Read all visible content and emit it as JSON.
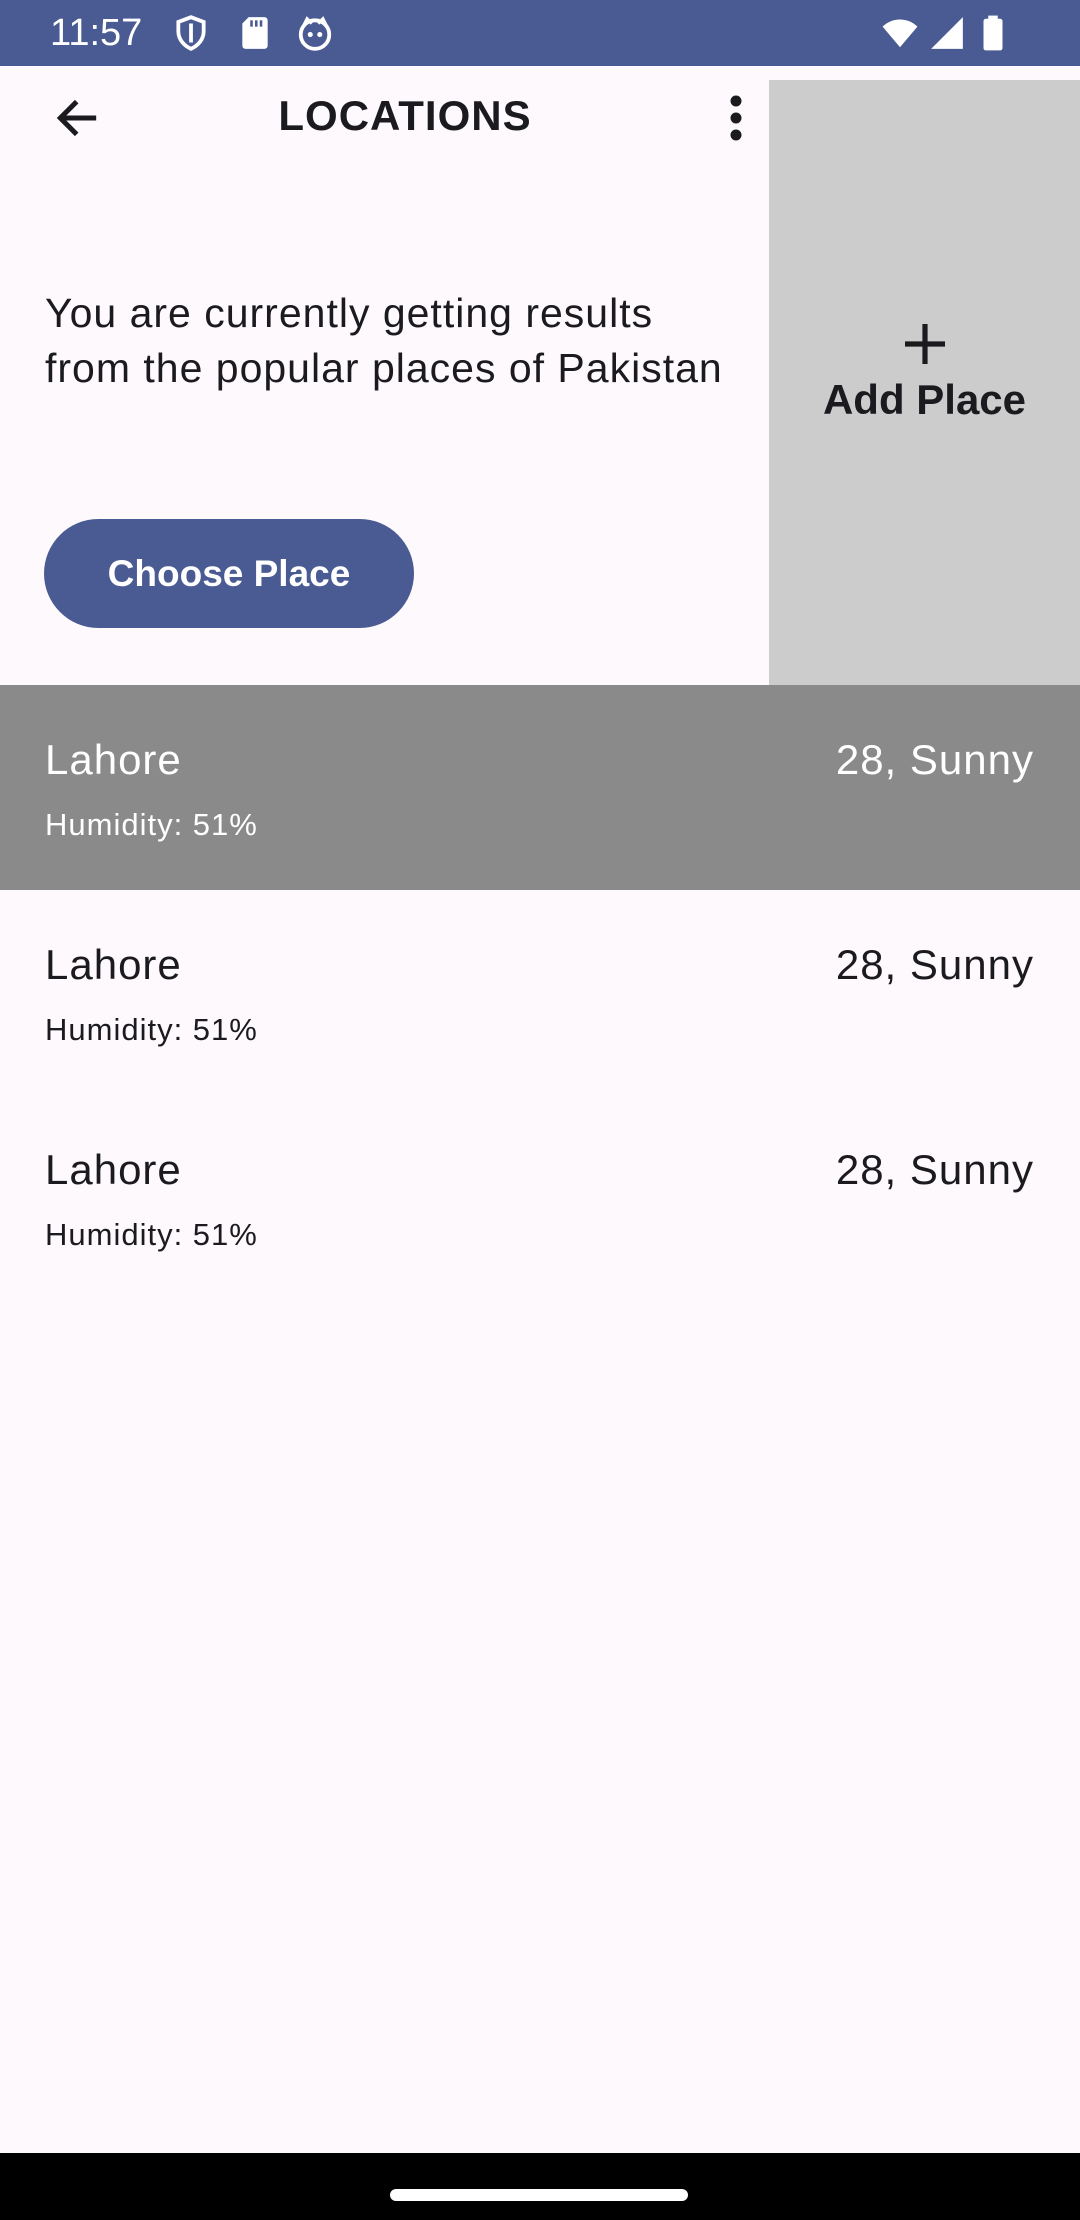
{
  "status_bar": {
    "time": "11:57",
    "left_icons": [
      "shield-icon",
      "sd-card-icon",
      "face-icon"
    ],
    "right_icons": [
      "wifi-icon",
      "signal-icon",
      "battery-icon"
    ],
    "background": "#4a5a92"
  },
  "app_bar": {
    "title": "LOCATIONS",
    "back_icon": "arrow-back-icon",
    "menu_icon": "more-vert-icon"
  },
  "add_place": {
    "icon": "plus-icon",
    "label": "Add Place",
    "background": "#cccccc"
  },
  "info": {
    "text": "You are currently getting results from the popular places of Pakistan"
  },
  "choose_place": {
    "label": "Choose Place",
    "color": "#4a5a92"
  },
  "locations": [
    {
      "city": "Lahore",
      "weather": "28, Sunny",
      "humidity": "Humidity: 51%",
      "selected": true
    },
    {
      "city": "Lahore",
      "weather": "28, Sunny",
      "humidity": "Humidity: 51%",
      "selected": false
    },
    {
      "city": "Lahore",
      "weather": "28, Sunny",
      "humidity": "Humidity: 51%",
      "selected": false
    }
  ],
  "colors": {
    "background": "#fdf9fd",
    "selected_row": "#8a8a8a"
  }
}
